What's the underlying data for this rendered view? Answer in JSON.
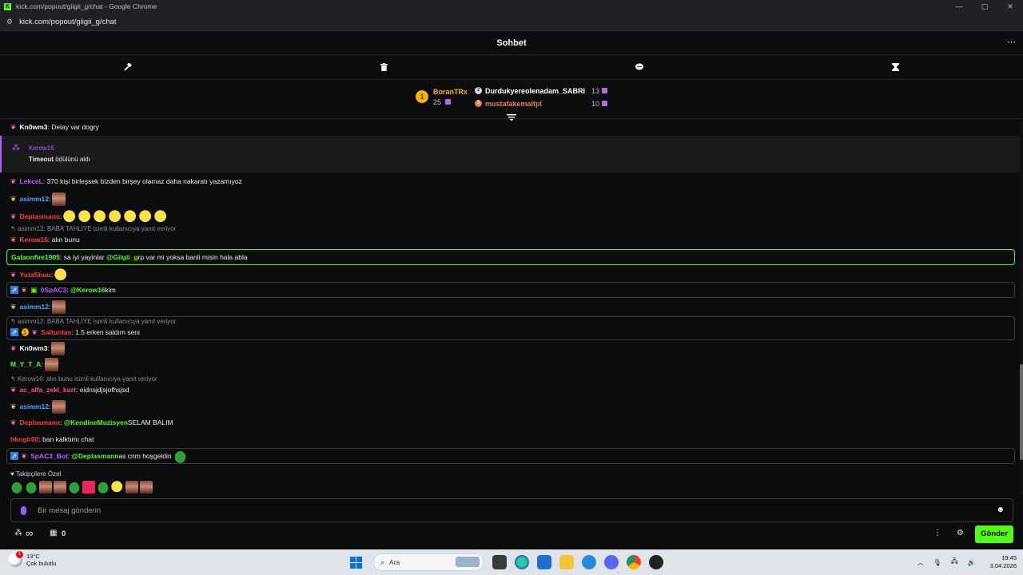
{
  "browser": {
    "window_title": "kick.com/popout/giigii_g/chat - Google Chrome",
    "favicon": "K",
    "url": "kick.com/popout/giigii_g/chat",
    "controls": [
      "—",
      "▢",
      "✕"
    ]
  },
  "header": {
    "title": "Sohbet",
    "more_icon": "⋯"
  },
  "mod_bar": {
    "icons": [
      "hammer-icon",
      "trash-icon",
      "chat-bubble-icon",
      "hourglass-icon"
    ]
  },
  "leaderboard": {
    "first": {
      "rank": "1",
      "name": "BoranTRx",
      "count": "25"
    },
    "second": {
      "rank": "2",
      "name": "Durdukyereolenadam_SABRI",
      "count": "13"
    },
    "third": {
      "rank": "3",
      "name": "mustafakemaltpl",
      "count": "10"
    }
  },
  "messages": [
    {
      "user": "Kn0wm3",
      "text": "Delay var dogry"
    },
    {
      "reward_user": "Kerow16",
      "reward_bold": "Timeout",
      "reward_rest": " ödülünü aldı"
    },
    {
      "user": "LekceL",
      "text": "370 kişi birleşsek bizden birşey olamaz daha nakaratı yazamıyoz"
    },
    {
      "user": "asimm12"
    },
    {
      "user": "Deplasmann"
    },
    {
      "reply": "asimm12: BABA TAHLİYE isimli kullanıcıya yanıt veriyor",
      "user": "Kerow16",
      "text": "alın bunu"
    },
    {
      "user": "Galaonfire1905",
      "text_a": "sa iyi yayinlar ",
      "mention": "@Giigii_g",
      "text_b": " rp var mi yoksa banli misin hala abla"
    },
    {
      "user": "YutaShuu"
    },
    {
      "user": "0SpAC3",
      "mention": "@Kerow16",
      "text": " kim"
    },
    {
      "user": "asimm12"
    },
    {
      "reply": "asimm12: BABA TAHLİYE isimli kullanıcıya yanıt veriyor",
      "user": "Saltuntas",
      "text": "1.5 erken saldım seni"
    },
    {
      "user": "Kn0wm3"
    },
    {
      "user": "M_Y_T_A"
    },
    {
      "reply": "Kerow16: alın bunu isimli kullanıcıya yanıt veriyor",
      "user": "ac_alfa_zeki_kurt",
      "text": "eidnsjdjsjofhsjsd"
    },
    {
      "user": "asimm12"
    },
    {
      "user": "Deplasmann",
      "mention": "@KendineMuzisyen",
      "text": " SELAM BALIM"
    },
    {
      "user": "hkngir00",
      "text": "ban kalktımı chat"
    },
    {
      "user": "SpAC3_Bot",
      "mention": "@Deplasmann",
      "text": " as cnm hoşgeldin"
    }
  ],
  "followers_only": "Takipçilere Özel",
  "input": {
    "placeholder": "Bir mesaj gönderin"
  },
  "footer": {
    "points": "∞",
    "store_count": "0",
    "send_label": "Gönder"
  },
  "taskbar": {
    "temp": "13°C",
    "weather": "Çok bulutlu",
    "weather_badge": "1",
    "search": "Ara",
    "time": "19:45",
    "date": "3.04.2026"
  },
  "colors": {
    "kick_green": "#53fc18",
    "purple": "#b35cff",
    "pink": "#ff4d8d",
    "blue": "#4aa3ff",
    "red": "#ff3b3b"
  }
}
